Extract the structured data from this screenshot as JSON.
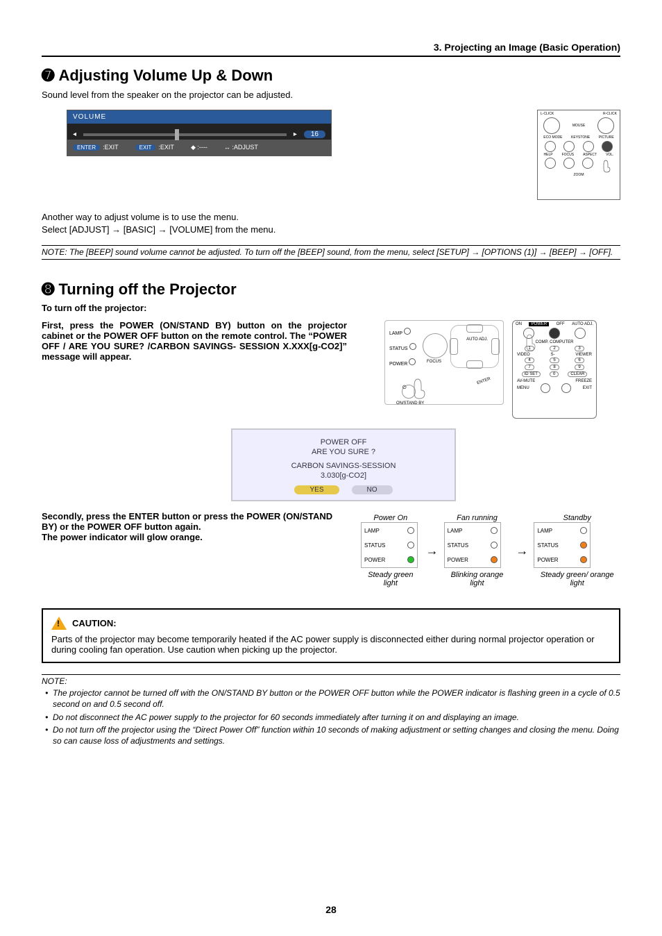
{
  "header": {
    "section_path": "3. Projecting an Image (Basic Operation)"
  },
  "s7": {
    "circled": "➐",
    "title": "Adjusting Volume Up & Down",
    "intro": "Sound level from the speaker on the projector can be adjusted.",
    "osd": {
      "title": "VOLUME",
      "value": "16",
      "foot_enter_btn": "ENTER",
      "foot_enter_label": ":EXIT",
      "foot_exit_btn": "EXIT",
      "foot_exit_label": ":EXIT",
      "foot_ud_label": ":----",
      "foot_lr_label": ":ADJUST"
    },
    "para2_a": "Another way to adjust volume is to use the menu.",
    "para2_b": "Select [ADJUST] → [BASIC] → [VOLUME] from the menu.",
    "note": "NOTE: The [BEEP] sound volume cannot be adjusted. To turn off the [BEEP] sound, from the menu, select [SETUP] → [OPTIONS (1)] → [BEEP] → [OFF]."
  },
  "remote1": {
    "l_click": "L-CLICK",
    "r_click": "R-CLICK",
    "mouse": "MOUSE",
    "eco": "ECO MODE",
    "keystone": "KEYSTONE",
    "picture": "PICTURE",
    "help": "HELP",
    "focus": "FOCUS",
    "aspect": "ASPECT",
    "vol": "VOL.",
    "zoom": "ZOOM"
  },
  "s8": {
    "circled": "➑",
    "title": "Turning off the Projector",
    "sub": "To turn off the projector:",
    "step1": "First, press the POWER (ON/STAND BY) button on the projector cabinet or the POWER OFF button on the remote control. The “POWER OFF / ARE YOU SURE? /CARBON SAVINGS- SESSION X.XXX[g-CO2]” message will appear.",
    "dialog": {
      "l1": "POWER OFF",
      "l2": "ARE YOU SURE ?",
      "l3": "CARBON SAVINGS-SESSION",
      "l4": "3.030[g-CO2]",
      "yes": "YES",
      "no": "NO"
    },
    "step2a": "Secondly, press the ENTER button or press the POWER (ON/STAND BY) or the POWER OFF button again.",
    "step2b": "The power indicator will glow orange.",
    "projector_labels": {
      "lamp": "LAMP",
      "status": "STATUS",
      "power": "POWER",
      "focus": "FOCUS",
      "auto_adj": "AUTO ADJ.",
      "standby": "ON/STAND BY",
      "enter": "ENTER"
    },
    "remote2": {
      "on": "ON",
      "power": "POWER",
      "off": "OFF",
      "auto_adj": "AUTO ADJ.",
      "comp": "COMP.",
      "computer": "COMPUTER",
      "video": "VIDEO",
      "svideo": "S-",
      "viewer": "VIEWER",
      "idset": "ID SET",
      "clear": "CLEAR",
      "avmute": "AV-MUTE",
      "freeze": "FREEZE",
      "menu": "MENU",
      "exit": "EXIT",
      "k1": "1",
      "k2": "2",
      "k3": "3",
      "k4": "4",
      "k5": "5",
      "k6": "6",
      "k7": "7",
      "k8": "8",
      "k9": "9",
      "k0": "0"
    },
    "lights": {
      "cols": [
        {
          "top": "Power On",
          "bottom": "Steady green light",
          "status_on": false,
          "power_color": "green"
        },
        {
          "top": "Fan running",
          "bottom": "Blinking orange light",
          "status_on": false,
          "power_color": "orange"
        },
        {
          "top": "Standby",
          "bottom": "Steady green/ orange light",
          "status_on": true,
          "power_color": "orange"
        }
      ],
      "lamp": "LAMP",
      "status": "STATUS",
      "power": "POWER"
    }
  },
  "caution": {
    "head": "CAUTION:",
    "body": "Parts of the projector may become temporarily heated if the AC power supply is disconnected either during normal projector operation or during cooling fan operation. Use caution when picking up the projector."
  },
  "notes": {
    "head": "NOTE:",
    "items": [
      "The projector cannot be turned off with the ON/STAND BY button or the POWER OFF button while the POWER indicator is flashing green in a cycle of 0.5 second on and 0.5 second off.",
      "Do not disconnect the AC power supply to the projector for 60 seconds immediately after turning it on and displaying an image.",
      "Do not turn off the projector using the “Direct Power Off” function within 10 seconds of making adjustment or setting changes and closing the menu. Doing so can cause loss of adjustments and settings."
    ]
  },
  "page_number": "28"
}
